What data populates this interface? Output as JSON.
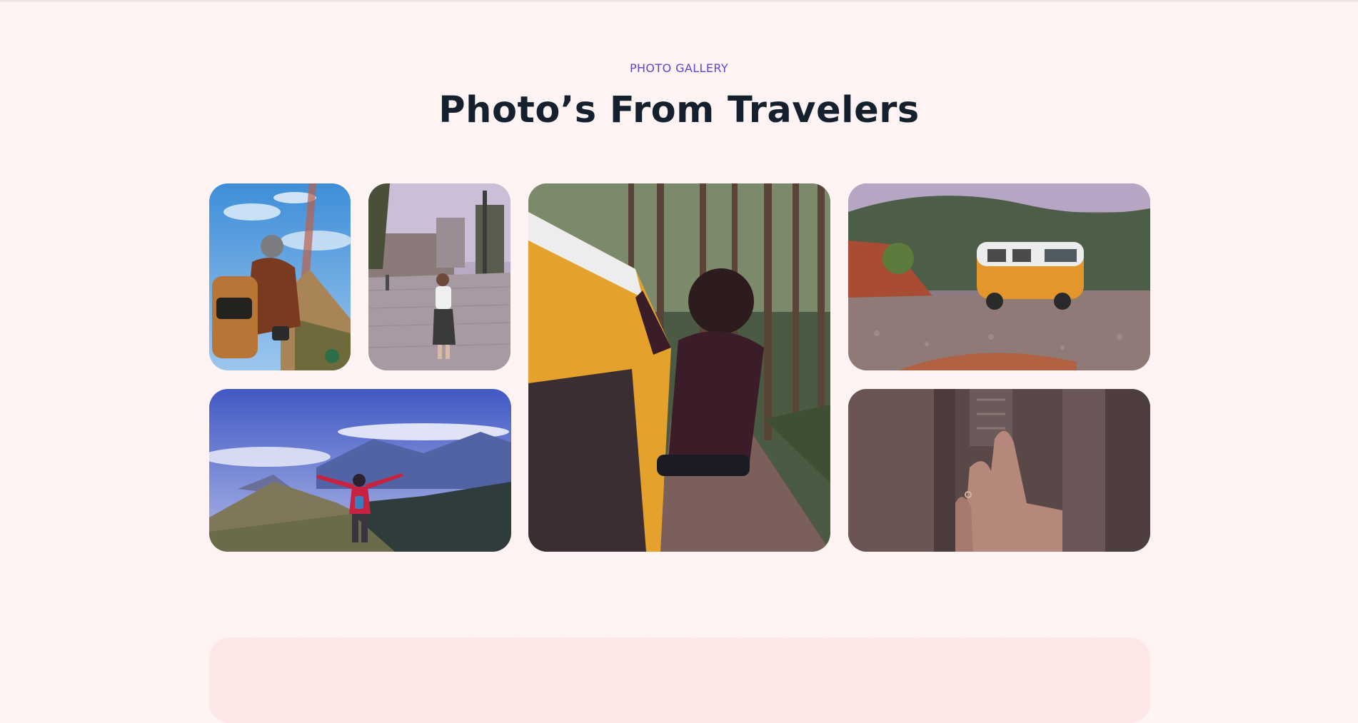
{
  "gallery": {
    "eyebrow": "PHOTO GALLERY",
    "title": "Photo’s From Travelers",
    "photos": [
      {
        "alt": "hiker-with-backpack-near-tower"
      },
      {
        "alt": "woman-walking-in-city-square"
      },
      {
        "alt": "person-leaning-out-of-yellow-van-in-forest"
      },
      {
        "alt": "orange-vintage-van-on-rocky-ground"
      },
      {
        "alt": "hiker-with-raised-arms-on-mountain"
      },
      {
        "alt": "hand-touching-carved-stone"
      }
    ]
  },
  "colors": {
    "background": "#fff4f3",
    "eyebrow": "#5b45d6",
    "title": "#15202f",
    "next_section": "#fde7e7"
  }
}
